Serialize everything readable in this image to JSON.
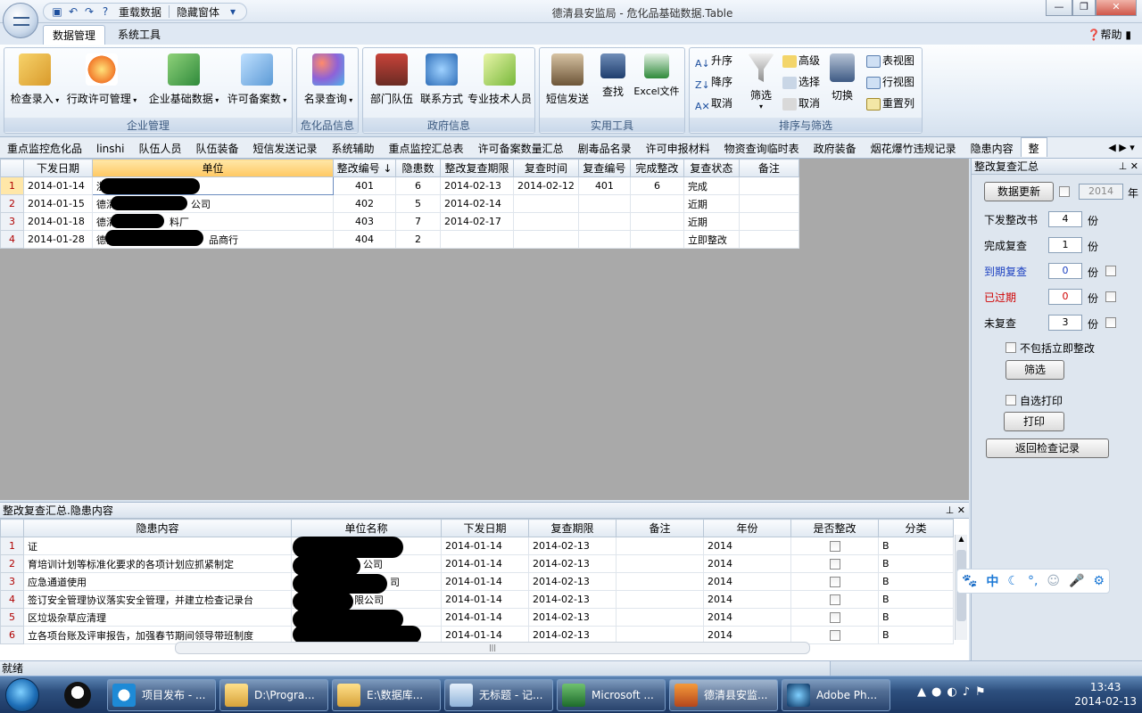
{
  "window": {
    "title": "德清县安监局 - 危化品基础数据.Table"
  },
  "qat": {
    "reload": "重载数据",
    "hide": "隐藏窗体"
  },
  "ribbon_tabs": [
    {
      "label": "数据管理"
    },
    {
      "label": "系统工具"
    }
  ],
  "help": "帮助",
  "groups": {
    "g1": {
      "label": "企业管理",
      "b1": "检查录入",
      "b2": "行政许可管理",
      "b3": "企业基础数据",
      "b4": "许可备案数"
    },
    "g2": {
      "label": "危化品信息",
      "b1": "名录查询"
    },
    "g3": {
      "label": "政府信息",
      "b1": "部门队伍",
      "b2": "联系方式",
      "b3": "专业技术人员"
    },
    "g4": {
      "label": "实用工具",
      "b1": "短信发送",
      "b2": "查找",
      "b3": "Excel文件"
    },
    "g5": {
      "label": "排序与筛选",
      "asc": "升序",
      "desc": "降序",
      "cancel1": "取消",
      "filter": "筛选",
      "advanced": "高级",
      "select": "选择",
      "cancel2": "取消",
      "switch": "切换",
      "tableview": "表视图",
      "rowview": "行视图",
      "resetcol": "重置列"
    }
  },
  "doc_tabs": [
    "重点监控危化品",
    "linshi",
    "队伍人员",
    "队伍装备",
    "短信发送记录",
    "系统辅助",
    "重点监控汇总表",
    "许可备案数量汇总",
    "剧毒品名录",
    "许可申报材料",
    "物资查询临时表",
    "政府装备",
    "烟花爆竹违规记录",
    "隐患内容",
    "整"
  ],
  "main_table": {
    "columns": [
      "下发日期",
      "单位",
      "整改编号 ↓",
      "隐患数",
      "整改复查期限",
      "复查时间",
      "复查编号",
      "完成整改",
      "复查状态",
      "备注"
    ],
    "rows": [
      {
        "n": "1",
        "date": "2014-01-14",
        "unit": "浙",
        "no": "401",
        "count": "6",
        "deadline": "2014-02-13",
        "rtime": "2014-02-12",
        "rno": "401",
        "done": "6",
        "status": "完成",
        "note": ""
      },
      {
        "n": "2",
        "date": "2014-01-15",
        "unit": "德清",
        "unit2": "公司",
        "no": "402",
        "count": "5",
        "deadline": "2014-02-14",
        "rtime": "",
        "rno": "",
        "done": "",
        "status": "近期",
        "note": ""
      },
      {
        "n": "3",
        "date": "2014-01-18",
        "unit": "德清",
        "unit2": "料厂",
        "no": "403",
        "count": "7",
        "deadline": "2014-02-17",
        "rtime": "",
        "rno": "",
        "done": "",
        "status": "近期",
        "note": ""
      },
      {
        "n": "4",
        "date": "2014-01-28",
        "unit": "德清",
        "unit2": "品商行",
        "no": "404",
        "count": "2",
        "deadline": "",
        "rtime": "",
        "rno": "",
        "done": "",
        "status": "立即整改",
        "note": ""
      }
    ]
  },
  "right_panel": {
    "title": "整改复查汇总",
    "refresh": "数据更新",
    "year_value": "2014",
    "year_unit": "年",
    "issued": {
      "label": "下发整改书",
      "value": "4"
    },
    "rechecked": {
      "label": "完成复查",
      "value": "1"
    },
    "due": {
      "label": "到期复查",
      "value": "0"
    },
    "overdue": {
      "label": "已过期",
      "value": "0"
    },
    "notchecked": {
      "label": "未复查",
      "value": "3"
    },
    "unit": "份",
    "exclude": "不包括立即整改",
    "filter": "筛选",
    "selfprint": "自选打印",
    "print": "打印",
    "back": "返回检查记录",
    "colors": {
      "due": "#1a3fc0",
      "overdue": "#d00000"
    }
  },
  "bottom_panel": {
    "title": "整改复查汇总.隐患内容",
    "columns": [
      "隐患内容",
      "单位名称",
      "下发日期",
      "复查期限",
      "备注",
      "年份",
      "是否整改",
      "分类"
    ],
    "rows": [
      {
        "n": "1",
        "content": "证",
        "unit": "",
        "date": "2014-01-14",
        "deadline": "2014-02-13",
        "note": "",
        "year": "2014",
        "cls": "B"
      },
      {
        "n": "2",
        "content": "育培训计划等标准化要求的各项计划应抓紧制定",
        "unit": "公司",
        "date": "2014-01-14",
        "deadline": "2014-02-13",
        "note": "",
        "year": "2014",
        "cls": "B"
      },
      {
        "n": "3",
        "content": "应急通道使用",
        "unit": "司",
        "date": "2014-01-14",
        "deadline": "2014-02-13",
        "note": "",
        "year": "2014",
        "cls": "B"
      },
      {
        "n": "4",
        "content": "签订安全管理协议落实安全管理，并建立检查记录台",
        "unit": "限公司",
        "date": "2014-01-14",
        "deadline": "2014-02-13",
        "note": "",
        "year": "2014",
        "cls": "B"
      },
      {
        "n": "5",
        "content": "区垃圾杂草应清理",
        "unit": "",
        "date": "2014-01-14",
        "deadline": "2014-02-13",
        "note": "",
        "year": "2014",
        "cls": "B"
      },
      {
        "n": "6",
        "content": "立各项台账及评审报告，加强春节期间领导带班制度",
        "unit": "",
        "date": "2014-01-14",
        "deadline": "2014-02-13",
        "note": "",
        "year": "2014",
        "cls": "B"
      }
    ]
  },
  "status": "就绪",
  "ime": {
    "mode": "中"
  },
  "taskbar": {
    "items": [
      "项目发布 - ...",
      "D:\\Progra...",
      "E:\\数据库...",
      "无标题 - 记...",
      "Microsoft ...",
      "德清县安监...",
      "Adobe Ph..."
    ],
    "time": "13:43",
    "date": "2014-02-13"
  }
}
